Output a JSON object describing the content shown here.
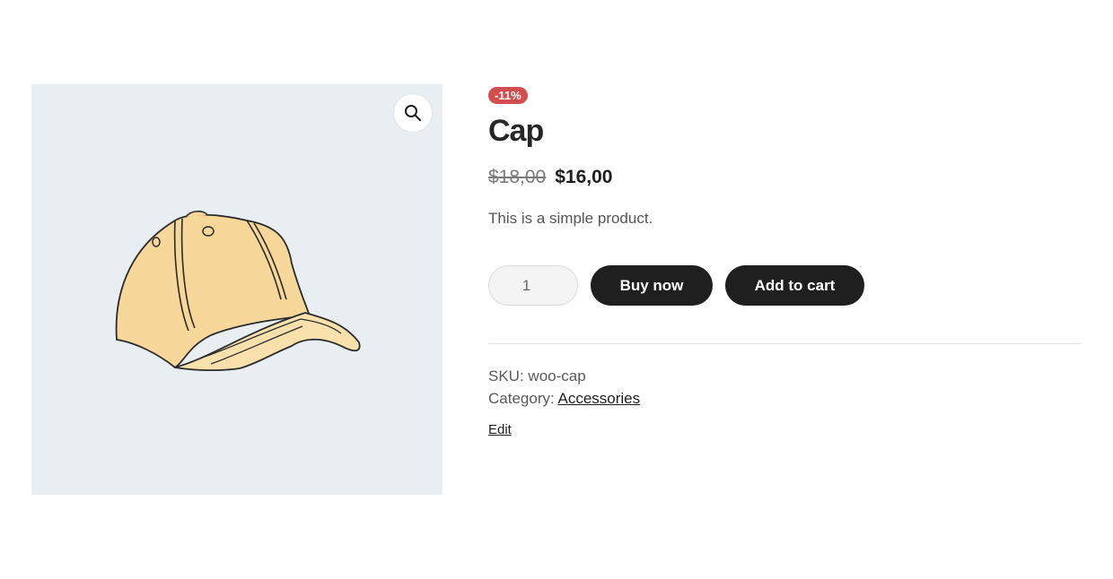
{
  "gallery": {
    "image_alt": "Cap",
    "zoom_icon": "magnifier-icon",
    "background": "#e9eef3",
    "cap_color": "#f7d89a"
  },
  "product": {
    "sale_badge": "-11%",
    "title": "Cap",
    "price_regular": "$18,00",
    "price_sale": "$16,00",
    "description": "This is a simple product.",
    "quantity": "1",
    "buy_now_label": "Buy now",
    "add_to_cart_label": "Add to cart"
  },
  "meta": {
    "sku_label": "SKU:",
    "sku_value": "woo-cap",
    "category_label": "Category:",
    "category_value": "Accessories",
    "edit_label": "Edit"
  },
  "colors": {
    "badge": "#d34e4e",
    "button": "#1f1f1f"
  }
}
